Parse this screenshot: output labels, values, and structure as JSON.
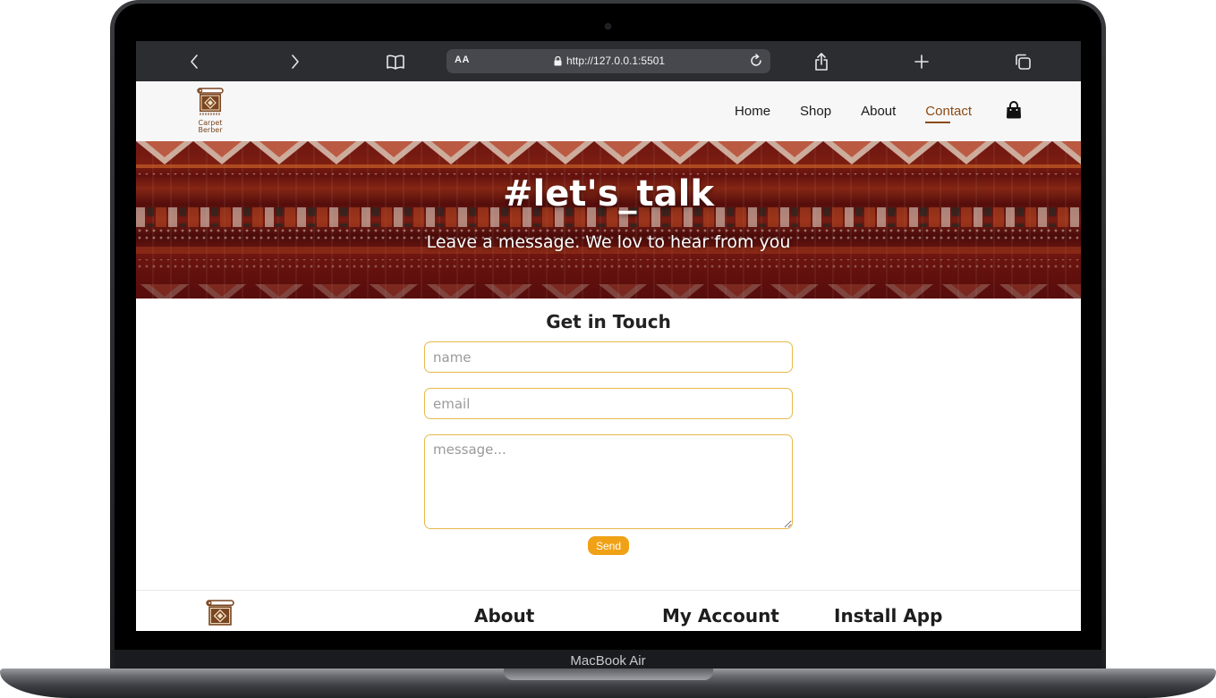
{
  "device": {
    "label": "MacBook Air"
  },
  "browser": {
    "text_size_label": "AA",
    "url": "http://127.0.0.1:5501"
  },
  "site": {
    "logo": {
      "line1": "Carpet",
      "line2": "Berber"
    },
    "nav": [
      {
        "label": "Home",
        "active": false
      },
      {
        "label": "Shop",
        "active": false
      },
      {
        "label": "About",
        "active": false
      },
      {
        "label": "Contact",
        "active": true
      }
    ],
    "accent_color": "#8b4a14"
  },
  "hero": {
    "title": "#let's_talk",
    "subtitle": "Leave a message. We lov to hear from you"
  },
  "contact_form": {
    "title": "Get in Touch",
    "name_placeholder": "name",
    "email_placeholder": "email",
    "message_placeholder": "message...",
    "send_label": "Send",
    "button_color": "#f0a116"
  },
  "footer": {
    "headings": [
      "About",
      "My Account",
      "Install App"
    ]
  }
}
